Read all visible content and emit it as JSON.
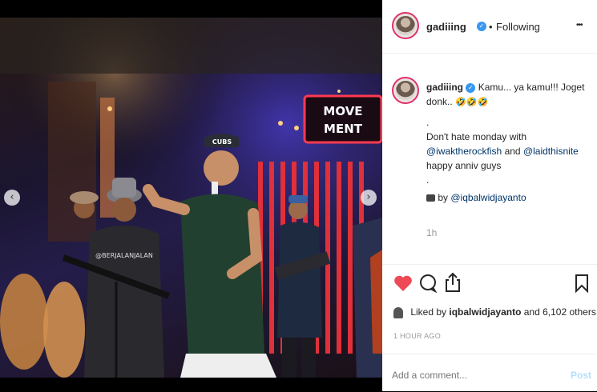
{
  "post": {
    "username": "gadiiing",
    "follow_status": "Following",
    "more_label": "•••",
    "caption_line1": "Kamu... ya kamu!!! Joget",
    "caption_line2": "donk..",
    "caption_emojis": "🤣🤣🤣",
    "dot1": ".",
    "line3": "Don't hate monday with",
    "mention1": "@iwaktherockfish",
    "and": "and",
    "mention2": "@laidthisnite",
    "line5": "happy anniv guys",
    "dot2": ".",
    "by_label": "by",
    "mention3": "@iqbalwidjayanto",
    "time_ago": "1h"
  },
  "likes": {
    "prefix": "Liked by",
    "user": "iqbalwidjayanto",
    "suffix": "and 6,102 others"
  },
  "timestamp": "1 HOUR AGO",
  "comment": {
    "placeholder": "Add a comment...",
    "post_label": "Post"
  },
  "photo": {
    "sign_line1": "MOVE",
    "sign_line2": "MENT",
    "cap_text": "CUBS",
    "shirt_text": "@BERJALANJALAN"
  },
  "colors": {
    "heart": "#ed4956",
    "link": "#003569",
    "verified": "#3897f0",
    "post_button": "#b2dffc"
  }
}
